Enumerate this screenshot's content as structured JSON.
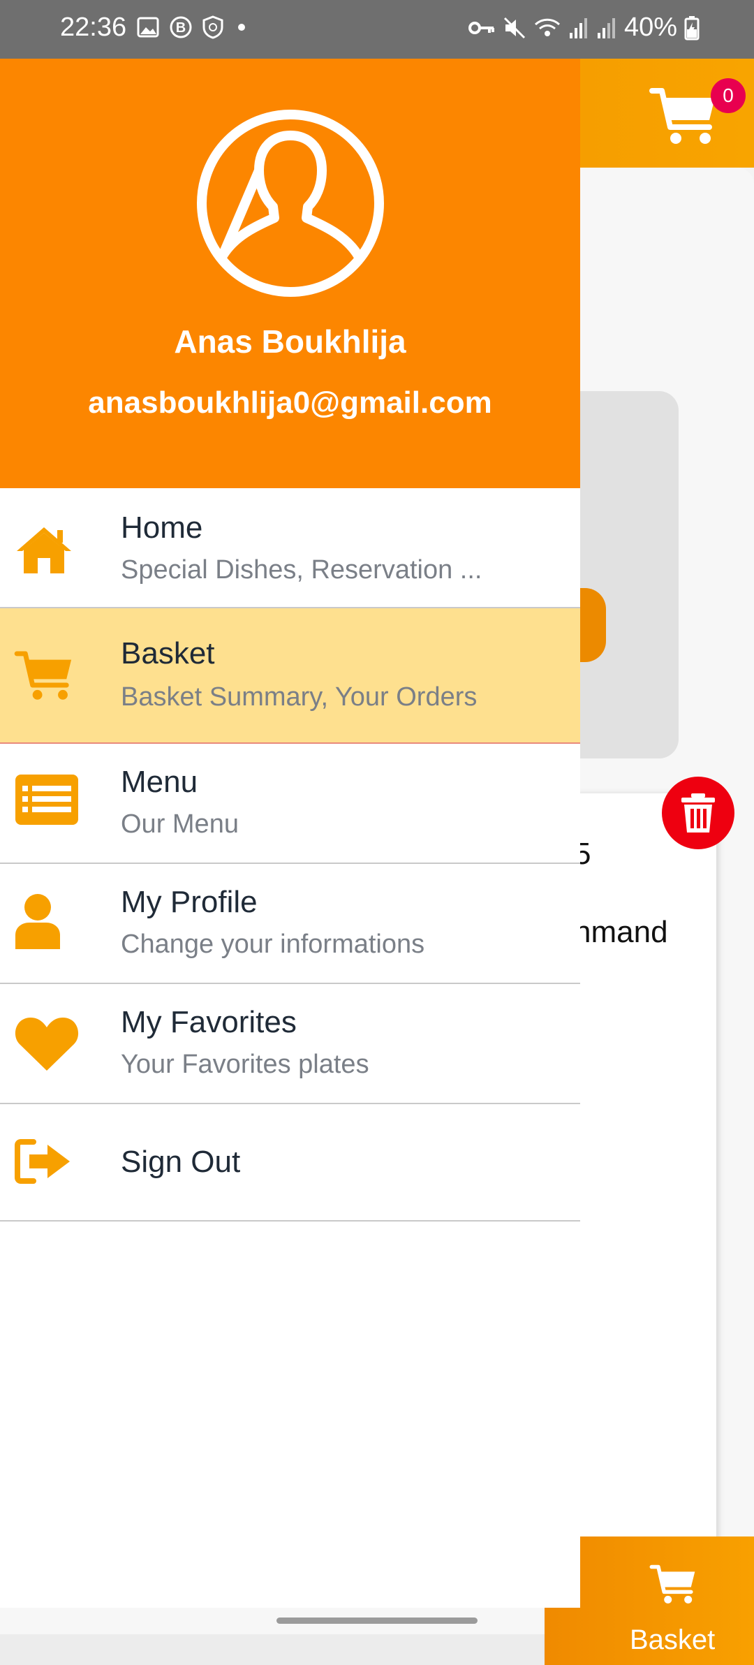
{
  "status": {
    "time": "22:36",
    "battery": "40%",
    "icons": [
      "image-icon",
      "b-app-icon",
      "shield-icon",
      "dot-icon",
      "key-icon",
      "mute-icon",
      "wifi-icon",
      "signal-icon",
      "signal-icon",
      "battery-icon"
    ]
  },
  "drawer": {
    "user_name": "Anas Boukhlija",
    "user_email": "anasboukhlija0@gmail.com",
    "items": [
      {
        "icon": "home-icon",
        "title": "Home",
        "subtitle": "Special Dishes, Reservation ..."
      },
      {
        "icon": "cart-icon",
        "title": "Basket",
        "subtitle": "Basket Summary, Your Orders",
        "active": true
      },
      {
        "icon": "menu-list-icon",
        "title": "Menu",
        "subtitle": "Our Menu"
      },
      {
        "icon": "user-icon",
        "title": "My Profile",
        "subtitle": "Change your informations"
      },
      {
        "icon": "heart-icon",
        "title": "My Favorites",
        "subtitle": "Your Favorites plates"
      },
      {
        "icon": "sign-out-icon",
        "title": "Sign Out",
        "subtitle": ""
      }
    ]
  },
  "background": {
    "cart_badge": "0",
    "partial_text_1": "5",
    "partial_text_2": "nmand",
    "bottom_tab_label": "Basket"
  },
  "colors": {
    "accent": "#FC8600",
    "icon": "#F7A000",
    "active_row": "#FEE08F",
    "delete": "#EE0010",
    "badge": "#E8004F"
  }
}
